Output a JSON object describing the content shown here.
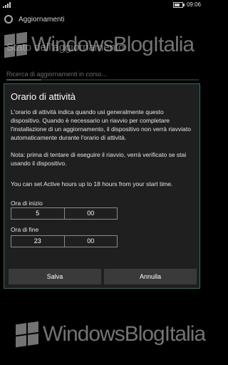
{
  "status_bar": {
    "time": "09:06"
  },
  "app": {
    "title": "Aggiornamenti"
  },
  "background": {
    "heading": "Stato dell'aggiornamento",
    "status": "Ricerca di aggiornamenti in corso...",
    "progress": 0.18
  },
  "watermark": {
    "text": "WindowsBlogItalia"
  },
  "dialog": {
    "title": "Orario di attività",
    "paragraph1": "L'orario di attività indica quando usi generalmente questo dispositivo. Quando è necessario un riavvio per completare l'installazione di un aggiornamento, il dispositivo non verrà riavviato automaticamente durante l'orario di attività.",
    "paragraph2": "Nota: prima di tentare di eseguire il riavvio, verrà verificato se stai usando il dispositivo.",
    "paragraph3": "You can set Active hours up to 18 hours from your start time.",
    "start_label": "Ora di inizio",
    "start_hour": "5",
    "start_minute": "00",
    "end_label": "Ora di fine",
    "end_hour": "23",
    "end_minute": "00",
    "save_label": "Salva",
    "cancel_label": "Annulla"
  },
  "colors": {
    "dialog_border": "#2e6d6a",
    "dialog_bg": "#1f1f1f",
    "button_bg": "#3a3a3a"
  }
}
